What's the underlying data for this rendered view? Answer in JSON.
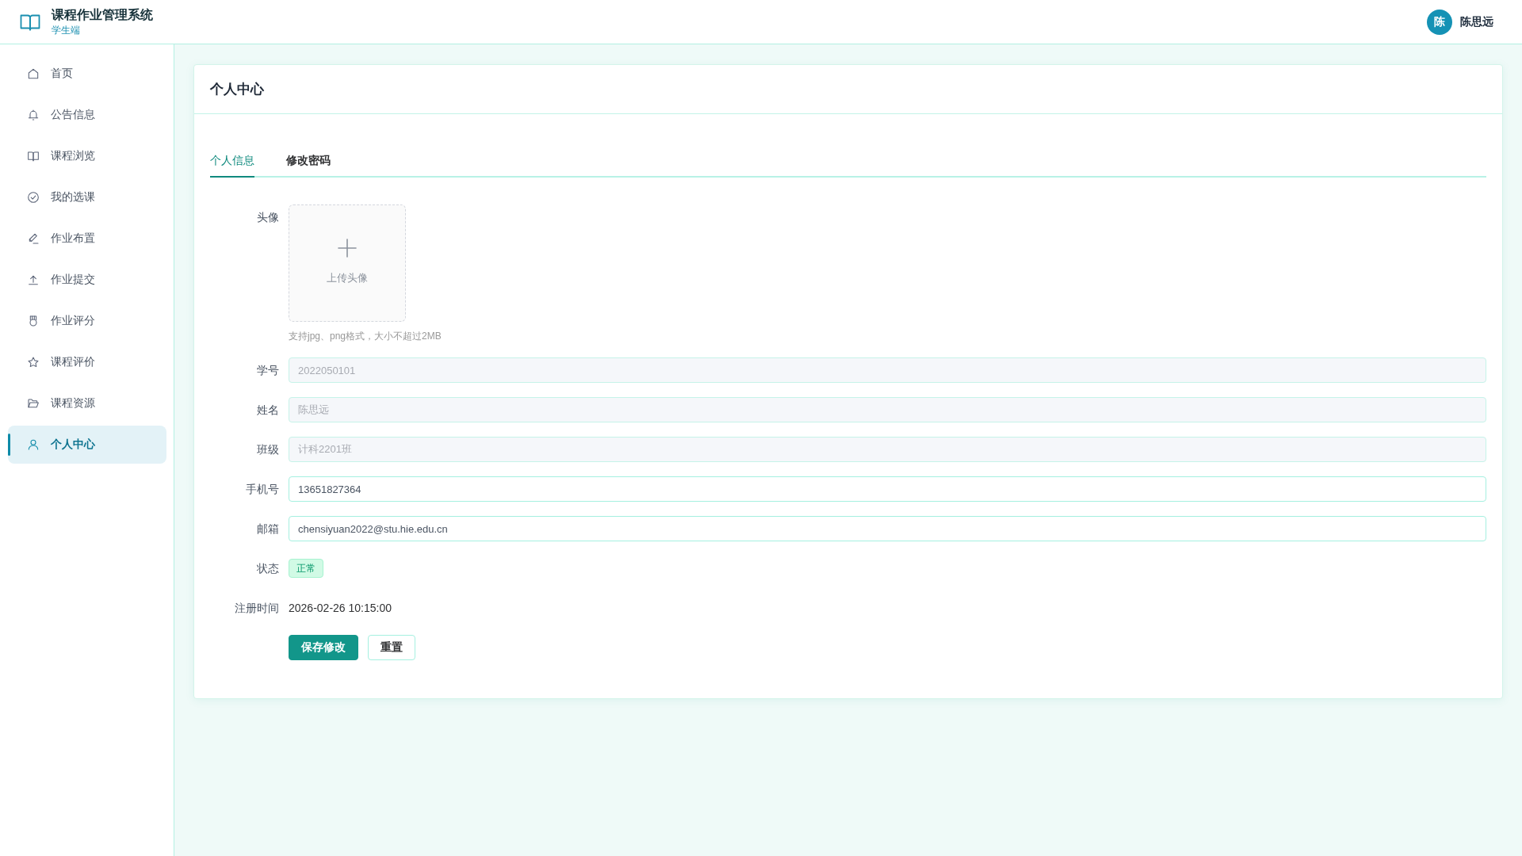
{
  "header": {
    "title": "课程作业管理系统",
    "subtitle": "学生端",
    "user": {
      "initial": "陈",
      "name": "陈思远"
    }
  },
  "sidebar": {
    "items": [
      {
        "label": "首页",
        "selected": false
      },
      {
        "label": "公告信息",
        "selected": false
      },
      {
        "label": "课程浏览",
        "selected": false
      },
      {
        "label": "我的选课",
        "selected": false
      },
      {
        "label": "作业布置",
        "selected": false
      },
      {
        "label": "作业提交",
        "selected": false
      },
      {
        "label": "作业评分",
        "selected": false
      },
      {
        "label": "课程评价",
        "selected": false
      },
      {
        "label": "课程资源",
        "selected": false
      },
      {
        "label": "个人中心",
        "selected": true
      }
    ]
  },
  "page": {
    "title": "个人中心",
    "tabs": [
      {
        "label": "个人信息",
        "selected": true
      },
      {
        "label": "修改密码",
        "selected": false
      }
    ],
    "form": {
      "rows": [
        {
          "kind": "upload",
          "label": "头像",
          "upload_text": "上传头像",
          "hint": "支持jpg、png格式，大小不超过2MB"
        },
        {
          "kind": "input",
          "label": "学号",
          "value": "2022050101",
          "disabled": true
        },
        {
          "kind": "input",
          "label": "姓名",
          "value": "陈思远",
          "disabled": true
        },
        {
          "kind": "input",
          "label": "班级",
          "value": "计科2201班",
          "disabled": true
        },
        {
          "kind": "input",
          "label": "手机号",
          "value": "13651827364",
          "disabled": false
        },
        {
          "kind": "input",
          "label": "邮箱",
          "value": "chensiyuan2022@stu.hie.edu.cn",
          "disabled": false
        },
        {
          "kind": "tag",
          "label": "状态",
          "value": "正常"
        },
        {
          "kind": "text",
          "label": "注册时间",
          "value": "2026-02-26 10:15:00"
        }
      ],
      "buttons": [
        {
          "label": "保存修改",
          "kind": "primary"
        },
        {
          "label": "重置",
          "kind": "plain"
        }
      ]
    }
  }
}
